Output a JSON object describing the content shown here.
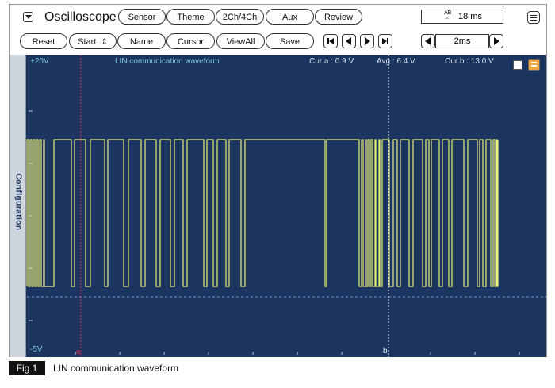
{
  "toolbar1": {
    "title": "Oscilloscope",
    "sensor": "Sensor",
    "theme": "Theme",
    "channels": "2Ch/4Ch",
    "aux": "Aux",
    "review": "Review",
    "ab_label": "AB",
    "time_value": "18 ms"
  },
  "toolbar2": {
    "reset": "Reset",
    "start": "Start",
    "start_arrow": "⇕",
    "name": "Name",
    "cursor": "Cursor",
    "viewall": "ViewAll",
    "save": "Save",
    "timebase": "2ms"
  },
  "scope": {
    "sidebar_label": "Configuration",
    "y_top": "+20V",
    "y_bottom": "-5V",
    "waveform_title": "LIN communication waveform",
    "cur_a": "Cur a : 0.9 V",
    "avg": "Avg : 6.4 V",
    "cur_b": "Cur b : 13.0 V",
    "cursor_a_marker": "a",
    "cursor_b_marker": "b"
  },
  "caption": {
    "fig": "Fig 1",
    "text": "LIN communication waveform"
  },
  "colors": {
    "scope_bg": "#1b3560",
    "trace": "#e8f07a",
    "label": "#7dc7e6",
    "cursor_a": "#d9364a",
    "cursor_b": "#e6eef5"
  }
}
